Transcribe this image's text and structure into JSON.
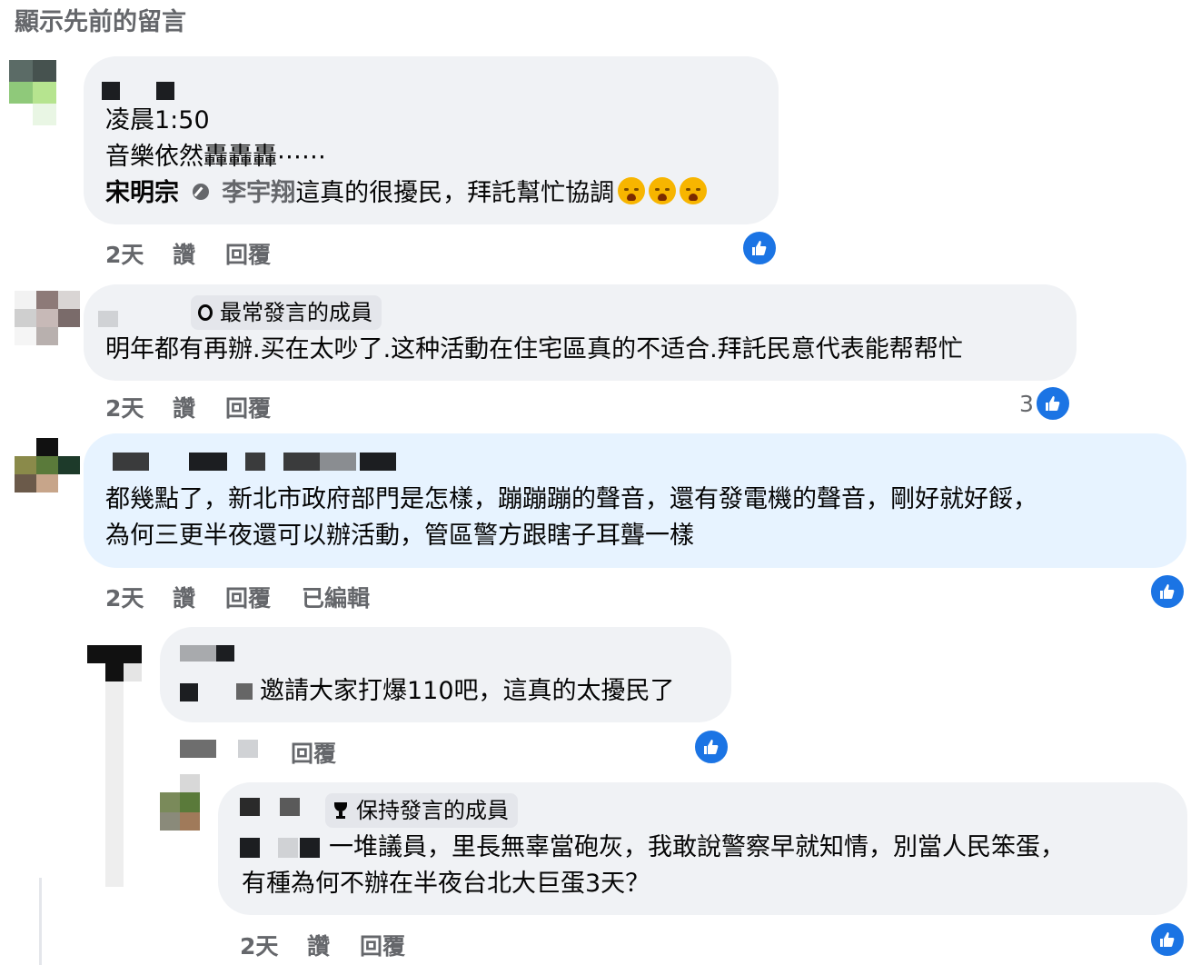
{
  "header": {
    "show_previous": "顯示先前的留言"
  },
  "comments": [
    {
      "lines": [
        "凌晨1:50",
        "音樂依然轟轟轟⋯⋯"
      ],
      "mention_name": "宋明宗",
      "tag_name": "李宇翔",
      "tail_text": "這真的很擾民，拜託幫忙協調",
      "emoji": "😭😭😭",
      "time": "2天",
      "like": "讚",
      "reply": "回覆"
    },
    {
      "badge": "最常發言的成員",
      "lines": [
        "明年都有再辦.买在太吵了.这种活動在住宅區真的不适合.拜託民意代表能帮帮忙"
      ],
      "time": "2天",
      "like": "讚",
      "reply": "回覆",
      "like_count": "3"
    },
    {
      "lines": [
        "都幾點了，新北市政府部門是怎樣，蹦蹦蹦的聲音，還有發電機的聲音，剛好就好餒，",
        "為何三更半夜還可以辦活動，管區警方跟瞎子耳聾一樣"
      ],
      "time": "2天",
      "like": "讚",
      "reply": "回覆",
      "edited": "已編輯"
    },
    {
      "lines": [
        "邀請大家打爆110吧，這真的太擾民了"
      ],
      "reply": "回覆"
    },
    {
      "badge": "保持發言的成員",
      "lines": [
        "一堆議員，里長無辜當砲灰，我敢說警察早就知情，別當人民笨蛋，",
        "有種為何不辦在半夜台北大巨蛋3天？"
      ],
      "time": "2天",
      "like": "讚",
      "reply": "回覆"
    }
  ],
  "colors": {
    "bubble": "#f0f2f5",
    "bubble_highlight": "#e7f3ff",
    "like_blue": "#1b74e4",
    "meta_gray": "#65676b"
  }
}
